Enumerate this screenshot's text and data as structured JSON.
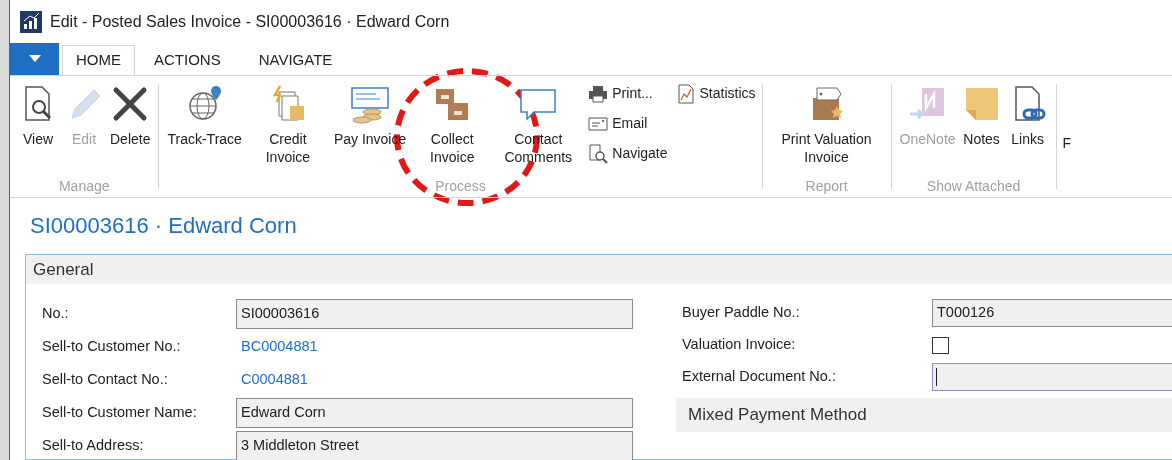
{
  "window": {
    "title": "Edit - Posted Sales Invoice - SI00003616 · Edward Corn"
  },
  "tabs": [
    {
      "label": "HOME",
      "selected": true
    },
    {
      "label": "ACTIONS",
      "selected": false
    },
    {
      "label": "NAVIGATE",
      "selected": false
    }
  ],
  "ribbon": {
    "groups": [
      {
        "label": "Manage",
        "buttons": [
          {
            "label": "View",
            "disabled": false
          },
          {
            "label": "Edit",
            "disabled": true
          },
          {
            "label": "Delete",
            "disabled": false
          }
        ]
      },
      {
        "label": "Process",
        "buttons": [
          {
            "label": "Track-Trace",
            "disabled": false
          },
          {
            "label": "Credit Invoice",
            "disabled": false
          },
          {
            "label": "Pay Invoice",
            "disabled": false
          },
          {
            "label": "Collect Invoice",
            "disabled": false
          },
          {
            "label": "Contact Comments",
            "disabled": false
          }
        ],
        "small_columns": [
          [
            {
              "label": "Print..."
            },
            {
              "label": "Email"
            },
            {
              "label": "Navigate"
            }
          ],
          [
            {
              "label": "Statistics"
            }
          ]
        ]
      },
      {
        "label": "Report",
        "buttons": [
          {
            "label": "Print Valuation Invoice",
            "disabled": false
          }
        ]
      },
      {
        "label": "Show Attached",
        "buttons": [
          {
            "label": "OneNote",
            "disabled": true
          },
          {
            "label": "Notes",
            "disabled": false
          },
          {
            "label": "Links",
            "disabled": false
          }
        ]
      }
    ],
    "partial_label": "F"
  },
  "page_title": "SI00003616 · Edward Corn",
  "section": {
    "title": "General",
    "left_fields": [
      {
        "label": "No.:",
        "kind": "readonly",
        "value": "SI00003616"
      },
      {
        "label": "Sell-to Customer No.:",
        "kind": "link",
        "value": "BC0004881"
      },
      {
        "label": "Sell-to Contact No.:",
        "kind": "link",
        "value": "C0004881"
      },
      {
        "label": "Sell-to Customer Name:",
        "kind": "readonly",
        "value": "Edward Corn"
      },
      {
        "label": "Sell-to Address:",
        "kind": "readonly",
        "value": "3 Middleton Street"
      }
    ],
    "right_fields": [
      {
        "label": "Buyer Paddle No.:",
        "kind": "readonly",
        "value": "T000126"
      },
      {
        "label": "Valuation Invoice:",
        "kind": "checkbox",
        "checked": false
      },
      {
        "label": "External Document No.:",
        "kind": "input"
      }
    ],
    "subsection": "Mixed Payment Method"
  }
}
